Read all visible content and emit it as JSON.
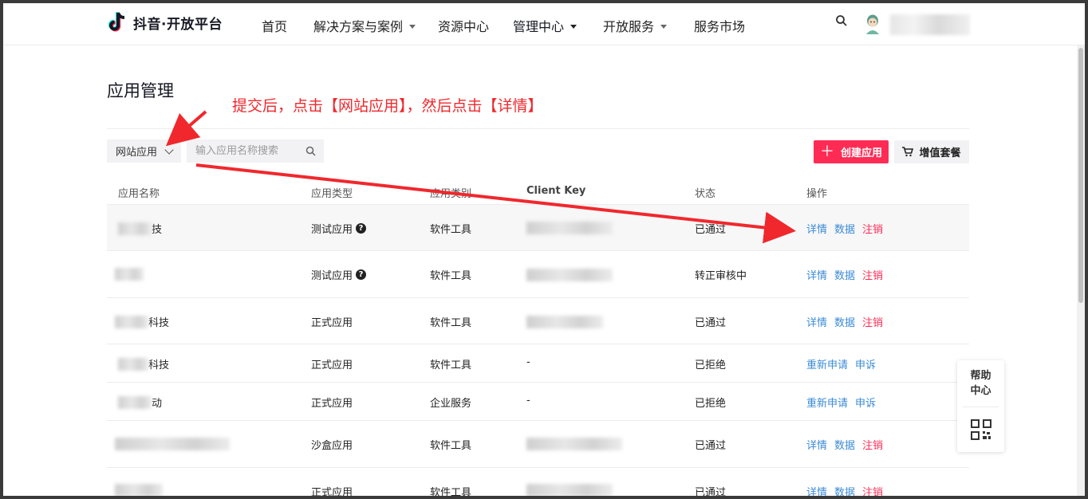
{
  "brand": {
    "logo_text": "抖音·开放平台"
  },
  "nav": {
    "items": [
      {
        "label": "首页"
      },
      {
        "label": "解决方案与案例"
      },
      {
        "label": "资源中心"
      },
      {
        "label": "管理中心"
      },
      {
        "label": "开放服务"
      },
      {
        "label": "服务市场"
      }
    ]
  },
  "page": {
    "title": "应用管理",
    "annotation": "提交后，点击【网站应用】，然后点击【详情】"
  },
  "toolbar": {
    "filter_value": "网站应用",
    "search_placeholder": "输入应用名称搜索",
    "create_label": "创建应用",
    "vas_label": "增值套餐"
  },
  "table": {
    "headers": [
      "应用名称",
      "应用类型",
      "应用类别",
      "Client Key",
      "状态",
      "操作"
    ],
    "rows": [
      {
        "name_suffix": "技",
        "type": "测试应用",
        "category": "软件工具",
        "status": "已通过",
        "actions": [
          "详情",
          "数据",
          "注销"
        ]
      },
      {
        "name_suffix": "",
        "type": "测试应用",
        "category": "软件工具",
        "status": "转正审核中",
        "actions": [
          "详情",
          "数据",
          "注销"
        ]
      },
      {
        "name_suffix": "科技",
        "type": "正式应用",
        "category": "软件工具",
        "status": "已通过",
        "actions": [
          "详情",
          "数据",
          "注销"
        ]
      },
      {
        "name_suffix": "科技",
        "type": "正式应用",
        "category": "软件工具",
        "client_key": "-",
        "status": "已拒绝",
        "actions": [
          "重新申请",
          "申诉"
        ]
      },
      {
        "name_suffix": "动",
        "type": "正式应用",
        "category": "企业服务",
        "client_key": "-",
        "status": "已拒绝",
        "actions": [
          "重新申请",
          "申诉"
        ]
      },
      {
        "name_suffix": "",
        "type": "沙盒应用",
        "category": "软件工具",
        "status": "已通过",
        "actions": [
          "详情",
          "数据",
          "注销"
        ]
      },
      {
        "name_suffix": "",
        "type": "正式应用",
        "category": "软件工具",
        "status": "已通过",
        "actions": [
          "详情",
          "数据",
          "注销"
        ]
      }
    ]
  },
  "help": {
    "line1": "帮助",
    "line2": "中心"
  },
  "icons": [
    "tiktok-logo-icon",
    "search-icon",
    "avatar-icon",
    "chevron-down-icon",
    "plus-icon",
    "cart-icon",
    "help-circle-icon",
    "qr-code-icon"
  ],
  "colors": {
    "accent": "#fe2c55",
    "link": "#3b8bd6",
    "annotation": "#f0282d"
  }
}
